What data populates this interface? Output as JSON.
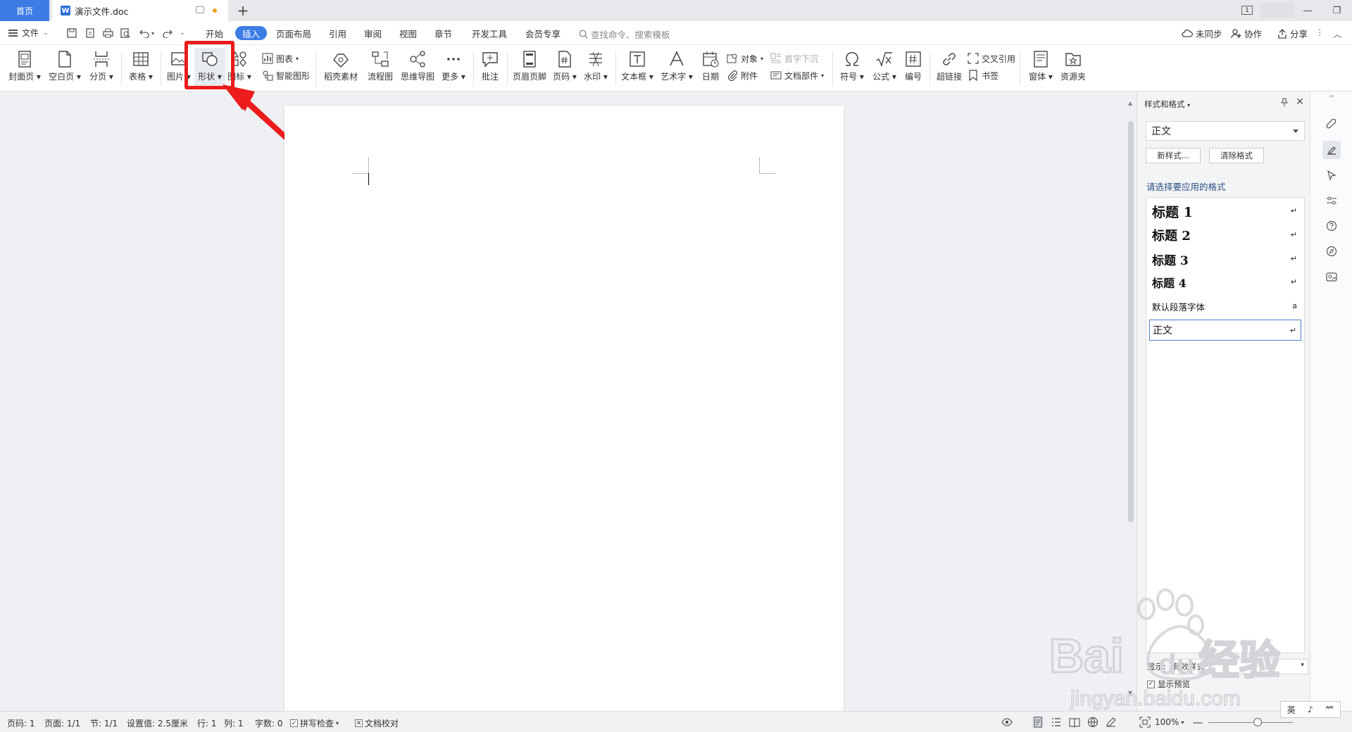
{
  "titlebar": {
    "home_tab": "首页",
    "doc_tab": "演示文件.doc",
    "doc_logo": "W",
    "new_tab": "+",
    "page_badge": "1",
    "minimize": "—",
    "restore": "❐",
    "close": "✕"
  },
  "menu": {
    "file": "文件",
    "tabs": [
      "开始",
      "插入",
      "页面布局",
      "引用",
      "审阅",
      "视图",
      "章节",
      "开发工具",
      "会员专享"
    ],
    "active_tab": "插入",
    "search": "查找命令、搜索模板",
    "sync": "未同步",
    "collab": "协作",
    "share": "分享"
  },
  "ribbon": {
    "cover": "封面页",
    "blank": "空白页",
    "pagebreak": "分页",
    "table": "表格",
    "picture": "图片",
    "shape": "形状",
    "icons": "图标",
    "chart": "图表",
    "smartart": "智能图形",
    "material": "稻壳素材",
    "flowchart": "流程图",
    "mindmap": "思维导图",
    "more": "更多",
    "comment": "批注",
    "header_footer": "页眉页脚",
    "page_number": "页码",
    "watermark": "水印",
    "textbox": "文本框",
    "wordart": "艺术字",
    "date": "日期",
    "object": "对象",
    "attachment": "附件",
    "dropcap": "首字下沉",
    "docparts": "文档部件",
    "symbol": "符号",
    "formula": "公式",
    "numbering": "编号",
    "hyperlink": "超链接",
    "crossref": "交叉引用",
    "bookmark": "书签",
    "window": "窗体",
    "resources": "资源夹"
  },
  "panel": {
    "title": "样式和格式",
    "current_style": "正文",
    "new_style": "新样式...",
    "clear_format": "清除格式",
    "hint": "请选择要应用的格式",
    "styles": [
      {
        "name": "标题  1",
        "mark": "↵"
      },
      {
        "name": "标题  2",
        "mark": "↵"
      },
      {
        "name": "标题  3",
        "mark": "↵"
      },
      {
        "name": "标题  4",
        "mark": "↵"
      },
      {
        "name": "默认段落字体",
        "mark": "a"
      },
      {
        "name": "正文",
        "mark": "↵"
      }
    ],
    "show_label": "显示:",
    "show_value": "有效样式",
    "preview_label": "显示预览"
  },
  "status": {
    "page_code": "页码: 1",
    "pages": "页面: 1/1",
    "section": "节: 1/1",
    "setting": "设置值: 2.5厘米",
    "row": "行: 1",
    "col": "列: 1",
    "words": "字数: 0",
    "spellcheck": "拼写检查",
    "proofread": "文档校对",
    "zoom": "100%"
  },
  "ime": {
    "a": "英",
    "b": "♪",
    "c": "⺮"
  },
  "watermark": {
    "brand": "Bai",
    "du": "du",
    "cn": "经验",
    "url": "jingyan.baidu.com"
  },
  "colors": {
    "accent": "#3c7ce4",
    "annotation": "#ec1c1c"
  }
}
